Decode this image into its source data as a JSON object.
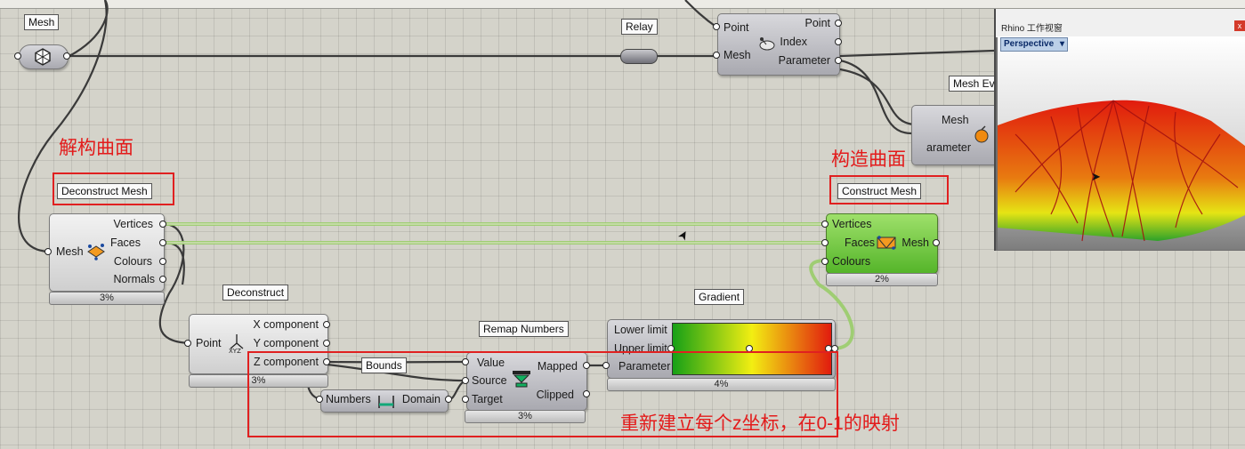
{
  "labels": {
    "mesh_param": "Mesh",
    "relay": "Relay",
    "mesh_eval": "Mesh Ev",
    "deconstruct_mesh": "Deconstruct Mesh",
    "construct_mesh": "Construct Mesh",
    "deconstruct": "Deconstruct",
    "gradient": "Gradient",
    "remap_numbers": "Remap Numbers",
    "bounds": "Bounds"
  },
  "annotations": {
    "deconstruct_cn": "解构曲面",
    "construct_cn": "构造曲面",
    "remap_cn": "重新建立每个z坐标，在0-1的映射"
  },
  "closest_point": {
    "in_point": "Point",
    "in_mesh": "Mesh",
    "out_point": "Point",
    "out_index": "Index",
    "out_parameter": "Parameter"
  },
  "mesh_eval": {
    "in_mesh": "Mesh",
    "in_parameter": "arameter"
  },
  "deconstruct_mesh": {
    "in_mesh": "Mesh",
    "out": [
      "Vertices",
      "Faces",
      "Colours",
      "Normals"
    ],
    "pct": "3%"
  },
  "construct_mesh": {
    "in": [
      "Vertices",
      "Faces",
      "Colours"
    ],
    "out_mesh": "Mesh",
    "pct": "2%"
  },
  "deconstruct_point": {
    "in_point": "Point",
    "out": [
      "X component",
      "Y component",
      "Z component"
    ],
    "pct": "3%"
  },
  "bounds": {
    "in_numbers": "Numbers",
    "out_domain": "Domain"
  },
  "remap": {
    "in": [
      "Value",
      "Source",
      "Target"
    ],
    "out": [
      "Mapped",
      "Clipped"
    ],
    "pct": "3%"
  },
  "gradient": {
    "in": [
      "Lower limit",
      "Upper limit",
      "Parameter"
    ],
    "pct": "4%",
    "colors": {
      "start": "#16a016",
      "mid": "#f2ee12",
      "end": "#e11b0e"
    }
  },
  "rhino": {
    "title": "Rhino 工作视窗",
    "viewport": "Perspective",
    "close": "x"
  },
  "colors": {
    "annotation_red": "#e31b1b",
    "component_green": "#66c236"
  }
}
